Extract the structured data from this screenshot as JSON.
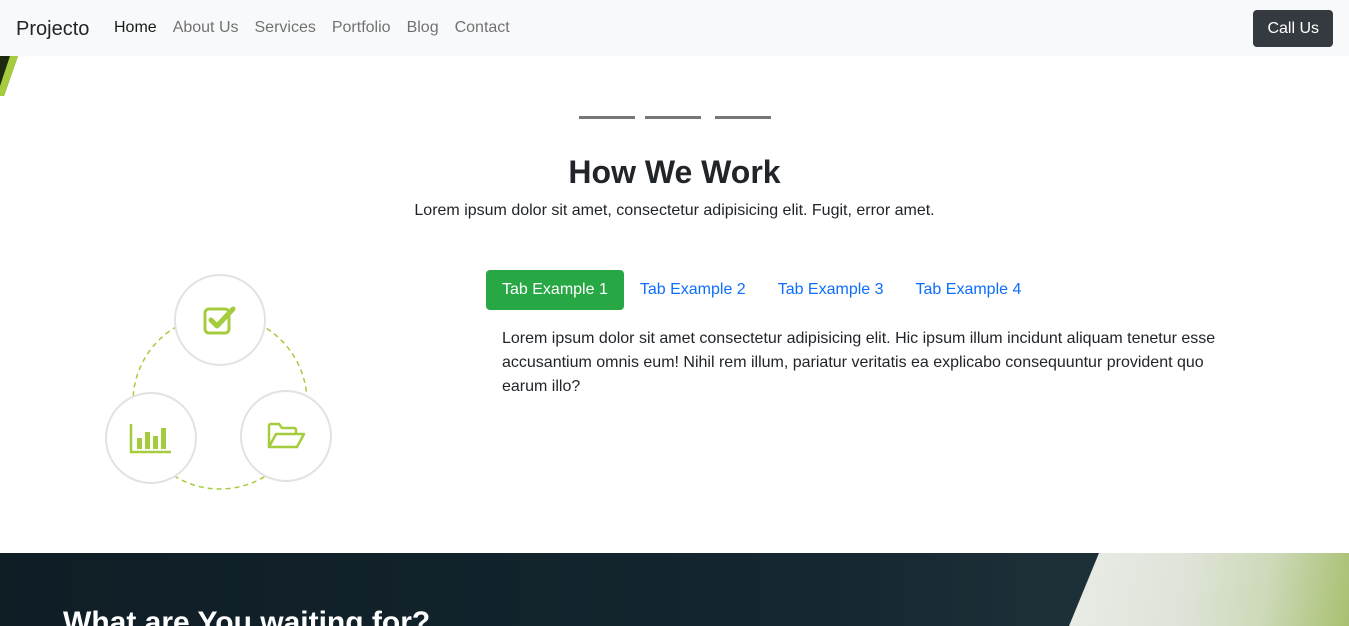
{
  "navbar": {
    "brand": "Projecto",
    "links": [
      "Home",
      "About Us",
      "Services",
      "Portfolio",
      "Blog",
      "Contact"
    ],
    "active_link": "Home",
    "cta_label": "Call Us"
  },
  "section": {
    "title": "How We Work",
    "subtitle": "Lorem ipsum dolor sit amet, consectetur adipisicing elit. Fugit, error amet."
  },
  "diagram": {
    "icons": [
      "checkbox-icon",
      "bar-chart-icon",
      "folder-open-icon"
    ],
    "accent_color": "#a4cc3c"
  },
  "tabs": {
    "items": [
      "Tab Example 1",
      "Tab Example 2",
      "Tab Example 3",
      "Tab Example 4"
    ],
    "active": "Tab Example 1",
    "active_color": "#28a745",
    "link_color": "#0d6efd",
    "content": "Lorem ipsum dolor sit amet consectetur adipisicing elit. Hic ipsum illum incidunt aliquam tenetur esse accusantium omnis eum! Nihil rem illum, pariatur veritatis ea explicabo consequuntur provident quo earum illo?"
  },
  "cta": {
    "title": "What are You waiting for?"
  }
}
